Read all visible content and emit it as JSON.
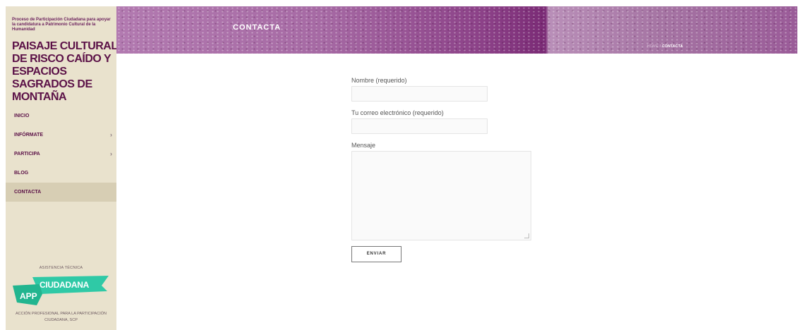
{
  "sidebar": {
    "intro": "Proceso de Participación Ciudadana para apoyar la candidatura a Patrimonio Cultural de la Humanidad",
    "title": "PAISAJE CULTURAL DE RISCO CAÍDO Y ESPACIOS SAGRADOS DE MONTAÑA",
    "nav": [
      {
        "label": "INICIO",
        "has_submenu": false
      },
      {
        "label": "INFÓRMATE",
        "has_submenu": true,
        "chevron": "›"
      },
      {
        "label": "PARTICIPA",
        "has_submenu": true,
        "chevron": "›"
      },
      {
        "label": "BLOG",
        "has_submenu": false
      },
      {
        "label": "CONTACTA",
        "has_submenu": false,
        "active": true
      }
    ],
    "footer_label": "ASISTENCIA TÉCNICA",
    "logo": {
      "word1": "CIUDADANA",
      "word2": "APP",
      "color": "#2fc9a6"
    },
    "footer_org": "ACCIÓN PROFESIONAL PARA LA PARTICIPACIÓN CIUDADANA, SCP"
  },
  "header": {
    "title": "CONTACTA",
    "breadcrumb": {
      "home": "HOME",
      "separator": " / ",
      "current": "CONTACTA"
    },
    "accent_color": "#7a2a75"
  },
  "form": {
    "name_label": "Nombre (requerido)",
    "name_value": "",
    "email_label": "Tu correo electrónico (requerido)",
    "email_value": "",
    "message_label": "Mensaje",
    "message_value": "",
    "submit_label": "ENVIAR"
  }
}
